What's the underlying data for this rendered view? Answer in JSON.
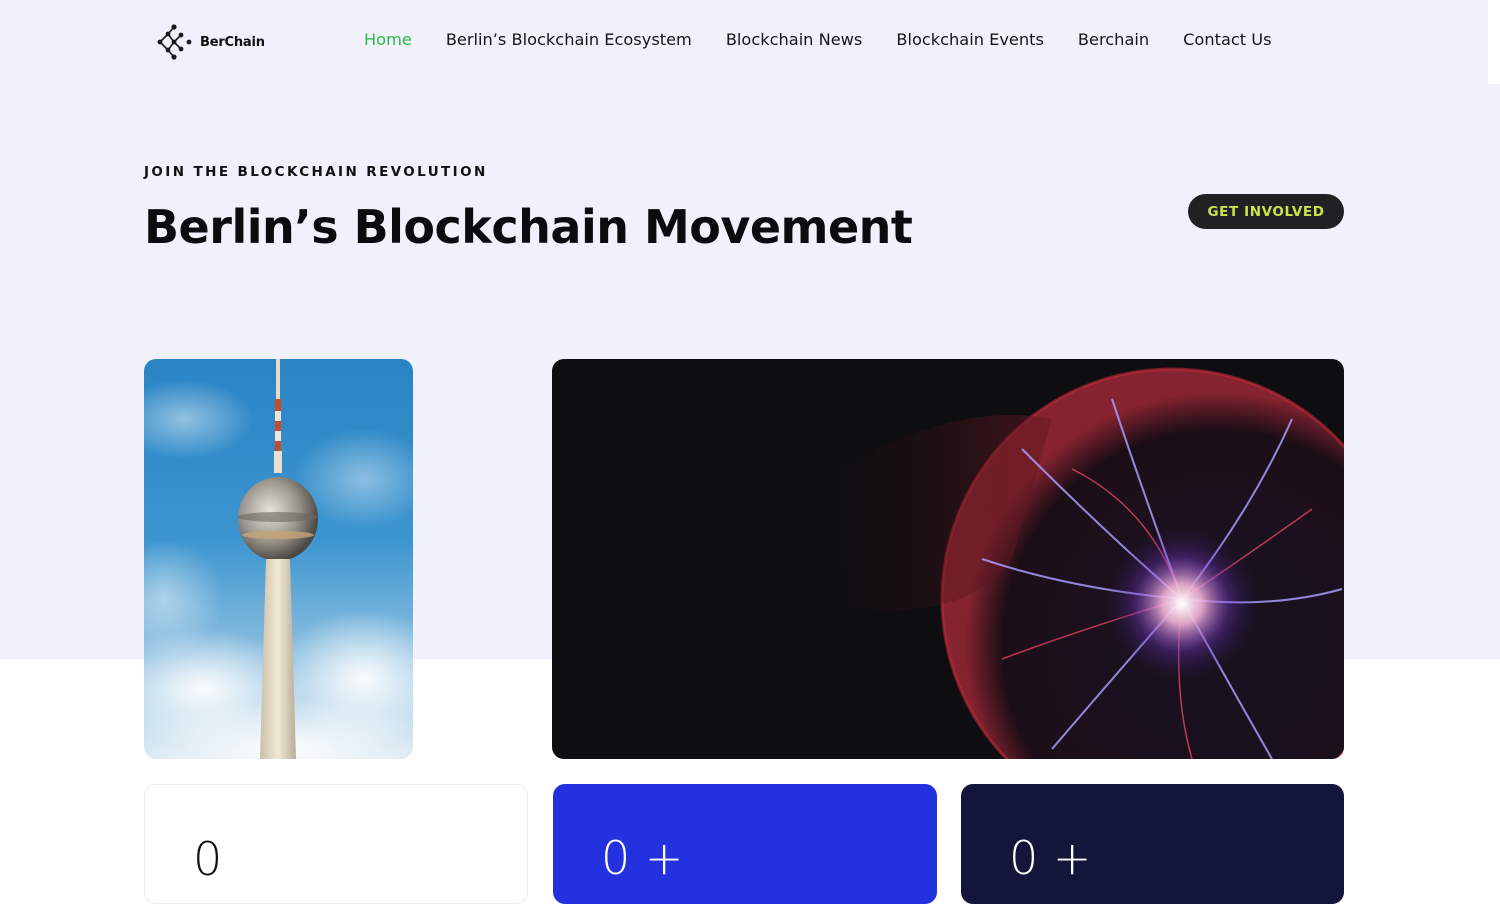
{
  "brand": {
    "name": "BerChain",
    "logo_icon": "molecule-logo-icon"
  },
  "nav": {
    "items": [
      {
        "label": "Home",
        "active": true
      },
      {
        "label": "Berlin’s Blockchain Ecosystem",
        "active": false
      },
      {
        "label": "Blockchain News",
        "active": false
      },
      {
        "label": "Blockchain Events",
        "active": false
      },
      {
        "label": "Berchain",
        "active": false
      },
      {
        "label": "Contact Us",
        "active": false
      }
    ]
  },
  "hero": {
    "eyebrow": "JOIN THE BLOCKCHAIN REVOLUTION",
    "title": "Berlin’s Blockchain Movement",
    "cta_label": "GET INVOLVED"
  },
  "stats": [
    {
      "value": "0"
    },
    {
      "value": "0 +"
    },
    {
      "value": "0 +"
    }
  ],
  "colors": {
    "accent_green": "#2fb94a",
    "hero_background": "#f1f1fb",
    "cta_background": "#1f2122",
    "cta_text": "#cbe44a",
    "card_blue": "#2331de",
    "card_navy": "#13153a"
  }
}
